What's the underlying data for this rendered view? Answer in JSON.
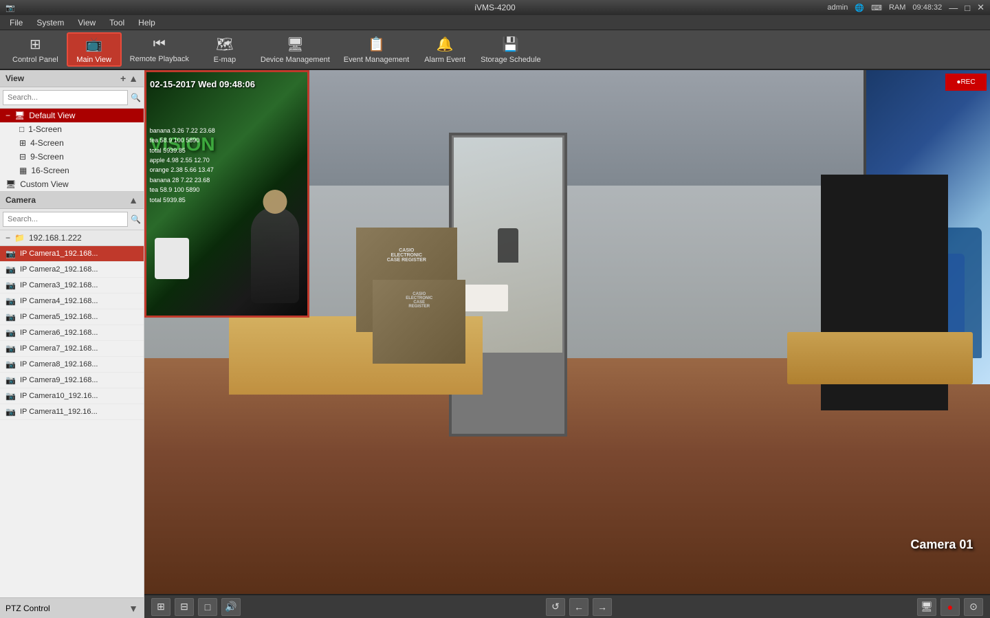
{
  "titleBar": {
    "appIcon": "📷",
    "appName": "iVMS-4200",
    "user": "admin",
    "time": "09:48:32",
    "minimizeBtn": "—",
    "maximizeBtn": "□",
    "closeBtn": "✕"
  },
  "menuBar": {
    "items": [
      "File",
      "System",
      "View",
      "Tool",
      "Help"
    ]
  },
  "toolbar": {
    "buttons": [
      {
        "id": "control-panel",
        "icon": "⊞",
        "label": "Control Panel",
        "active": false
      },
      {
        "id": "main-view",
        "icon": "📺",
        "label": "Main View",
        "active": true
      },
      {
        "id": "remote-playback",
        "icon": "⏮",
        "label": "Remote Playback",
        "active": false
      },
      {
        "id": "emap",
        "icon": "🗺",
        "label": "E-map",
        "active": false
      },
      {
        "id": "device-mgmt",
        "icon": "🖥",
        "label": "Device Management",
        "active": false
      },
      {
        "id": "event-mgmt",
        "icon": "📋",
        "label": "Event Management",
        "active": false
      },
      {
        "id": "alarm-event",
        "icon": "🔔",
        "label": "Alarm Event",
        "active": false
      },
      {
        "id": "storage-schedule",
        "icon": "💾",
        "label": "Storage Schedule",
        "active": false
      }
    ]
  },
  "viewPanel": {
    "title": "View",
    "searchPlaceholder": "Search...",
    "addBtn": "+",
    "collapseBtn": "▲",
    "tree": [
      {
        "id": "default-view",
        "label": "Default View",
        "icon": "🖥",
        "level": 0,
        "expanded": true,
        "selected": true
      },
      {
        "id": "1-screen",
        "label": "1-Screen",
        "icon": "□",
        "level": 1
      },
      {
        "id": "4-screen",
        "label": "4-Screen",
        "icon": "⊞",
        "level": 1
      },
      {
        "id": "9-screen",
        "label": "9-Screen",
        "icon": "⊟",
        "level": 1
      },
      {
        "id": "16-screen",
        "label": "16-Screen",
        "icon": "▦",
        "level": 1
      },
      {
        "id": "custom-view",
        "label": "Custom View",
        "icon": "🖥",
        "level": 0
      }
    ]
  },
  "cameraPanel": {
    "title": "Camera",
    "searchPlaceholder": "Search...",
    "collapseBtn": "▲",
    "groups": [
      {
        "id": "group-192",
        "label": "192.168.1.222",
        "icon": "📁",
        "cameras": [
          {
            "id": "cam1",
            "label": "IP Camera1_192.168...",
            "selected": true
          },
          {
            "id": "cam2",
            "label": "IP Camera2_192.168..."
          },
          {
            "id": "cam3",
            "label": "IP Camera3_192.168..."
          },
          {
            "id": "cam4",
            "label": "IP Camera4_192.168..."
          },
          {
            "id": "cam5",
            "label": "IP Camera5_192.168..."
          },
          {
            "id": "cam6",
            "label": "IP Camera6_192.168..."
          },
          {
            "id": "cam7",
            "label": "IP Camera7_192.168..."
          },
          {
            "id": "cam8",
            "label": "IP Camera8_192.168..."
          },
          {
            "id": "cam9",
            "label": "IP Camera9_192.168..."
          },
          {
            "id": "cam10",
            "label": "IP Camera10_192.16..."
          },
          {
            "id": "cam11",
            "label": "IP Camera11_192.16..."
          }
        ]
      }
    ]
  },
  "ptzPanel": {
    "title": "PTZ Control",
    "collapseBtn": "▼"
  },
  "videoOverlay": {
    "timestamp": "02-15-2017 Wed 09:48:06",
    "cameraLabel": "Camera 01",
    "storeData": [
      "banana 3.26 7.22 23.68",
      "tea 58.9 100 5890",
      "total 5939.85",
      "apple 4.98 2.55 12.70",
      "orange 2.38 5.66 13.47",
      "banana 28 7.22 23.68",
      "tea 58.9 100 5890",
      "total 5939.85"
    ]
  },
  "bottomToolbar": {
    "leftButtons": [
      "⊞",
      "⊟",
      "□",
      "🔊"
    ],
    "centerButtons": [
      "↺",
      "←",
      "→"
    ],
    "rightButtons": [
      "🖥",
      "●",
      "⊙"
    ]
  }
}
